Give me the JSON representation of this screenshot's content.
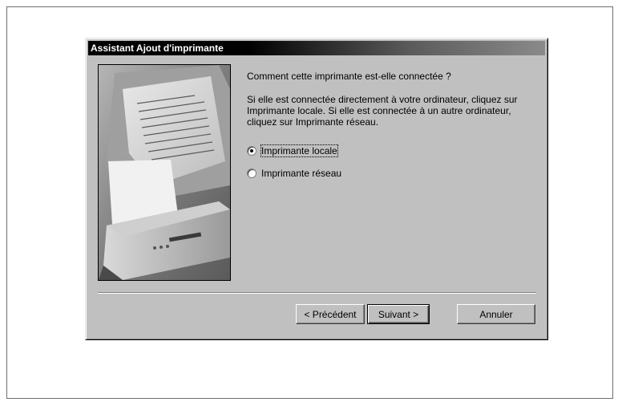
{
  "dialog": {
    "title": "Assistant Ajout d'imprimante"
  },
  "content": {
    "question": "Comment cette imprimante est-elle connectée ?",
    "description": "Si elle est connectée directement à votre ordinateur, cliquez sur Imprimante locale. Si elle est connectée à un autre ordinateur, cliquez sur Imprimante réseau.",
    "options": [
      {
        "label": "Imprimante locale",
        "checked": true
      },
      {
        "label": "Imprimante réseau",
        "checked": false
      }
    ]
  },
  "buttons": {
    "back": "< Précédent",
    "next": "Suivant >",
    "cancel": "Annuler"
  },
  "colors": {
    "dialog_bg": "#c0c0c0",
    "titlebar_start": "#000000",
    "titlebar_end": "#8a8a8a"
  },
  "icons": {
    "wizard_image": "printer-illustration"
  }
}
